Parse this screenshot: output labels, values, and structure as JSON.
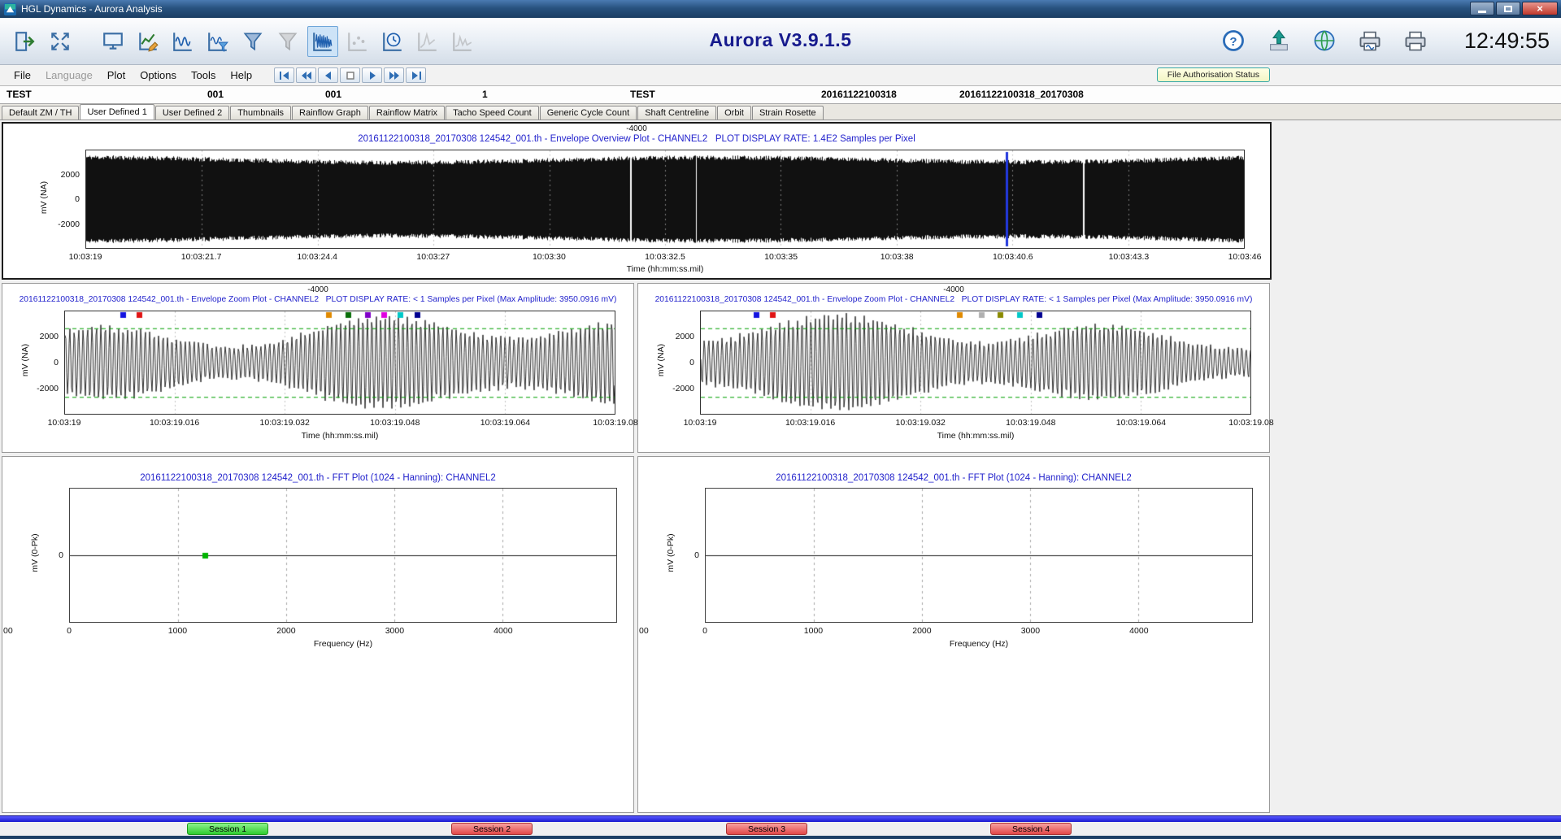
{
  "window": {
    "title": "HGL Dynamics - Aurora Analysis",
    "app_title": "Aurora V3.9.1.5",
    "clock": "12:49:55"
  },
  "toolbar": {
    "left_icons": [
      {
        "name": "exit-icon",
        "shape": "exit"
      },
      {
        "name": "fullscreen-icon",
        "shape": "fullscreen"
      },
      {
        "name": "display-setup-icon",
        "shape": "monitor",
        "gap_before": true
      },
      {
        "name": "plot-setup-icon",
        "shape": "chartpencil"
      },
      {
        "name": "waveform-plot-icon",
        "shape": "wave"
      },
      {
        "name": "filtered-plot-icon",
        "shape": "wavefilter"
      },
      {
        "name": "filter-icon",
        "shape": "funnel"
      },
      {
        "name": "filter-disabled-icon",
        "shape": "funnel",
        "disabled": true
      },
      {
        "name": "envelope-plot-icon",
        "shape": "envelope",
        "selected": true
      },
      {
        "name": "scatter-plot-icon",
        "shape": "chart",
        "disabled": true
      },
      {
        "name": "clock-plot-icon",
        "shape": "clockchart"
      },
      {
        "name": "spectrum-plot-icon",
        "shape": "wave2",
        "disabled": true
      },
      {
        "name": "spectrum2-plot-icon",
        "shape": "wave3",
        "disabled": true
      }
    ],
    "right_icons": [
      {
        "name": "help-icon",
        "shape": "help"
      },
      {
        "name": "upload-icon",
        "shape": "upload"
      },
      {
        "name": "globe-icon",
        "shape": "globe"
      },
      {
        "name": "print-preview-icon",
        "shape": "printwave"
      },
      {
        "name": "print-icon",
        "shape": "printer"
      }
    ]
  },
  "menubar": {
    "menus": [
      {
        "label": "File",
        "disabled": false
      },
      {
        "label": "Language",
        "disabled": true
      },
      {
        "label": "Plot",
        "disabled": false
      },
      {
        "label": "Options",
        "disabled": false
      },
      {
        "label": "Tools",
        "disabled": false
      },
      {
        "label": "Help",
        "disabled": false
      }
    ],
    "nav_buttons": [
      {
        "name": "nav-first-button",
        "shape": "first"
      },
      {
        "name": "nav-rewind-button",
        "shape": "prev2"
      },
      {
        "name": "nav-previous-button",
        "shape": "prev"
      },
      {
        "name": "nav-stop-button",
        "shape": "stop"
      },
      {
        "name": "nav-next-button",
        "shape": "next"
      },
      {
        "name": "nav-forward-button",
        "shape": "next2"
      },
      {
        "name": "nav-last-button",
        "shape": "last"
      }
    ],
    "file_auth_button": "File Authorisation Status"
  },
  "info_fields": [
    "TEST",
    "001",
    "001",
    "1",
    "TEST",
    "20161122100318",
    "20161122100318_20170308"
  ],
  "tabs": [
    {
      "label": "Default ZM / TH",
      "active": false
    },
    {
      "label": "User Defined 1",
      "active": true
    },
    {
      "label": "User Defined 2",
      "active": false
    },
    {
      "label": "Thumbnails",
      "active": false
    },
    {
      "label": "Rainflow Graph",
      "active": false
    },
    {
      "label": "Rainflow Matrix",
      "active": false
    },
    {
      "label": "Tacho Speed Count",
      "active": false
    },
    {
      "label": "Generic Cycle Count",
      "active": false
    },
    {
      "label": "Shaft Centreline",
      "active": false
    },
    {
      "label": "Orbit",
      "active": false
    },
    {
      "label": "Strain Rosette",
      "active": false
    }
  ],
  "plots": {
    "overview": {
      "top_label": "-4000",
      "title": "20161122100318_20170308 124542_001.th - Envelope Overview Plot - CHANNEL2   PLOT DISPLAY RATE: 1.4E2 Samples per Pixel",
      "y_label": "mV (NA)",
      "y_ticks": [
        "2000",
        "0",
        "-2000"
      ],
      "x_ticks": [
        "10:03:19",
        "10:03:21.7",
        "10:03:24.4",
        "10:03:27",
        "10:03:30",
        "10:03:32.5",
        "10:03:35",
        "10:03:38",
        "10:03:40.6",
        "10:03:43.3",
        "10:03:46"
      ],
      "x_label": "Time (hh:mm:ss.mil)",
      "waveform_color": "#111111",
      "cursor_color": "#2238dd",
      "cursor_fraction": 0.795
    },
    "zoom_left": {
      "top_label": "-4000",
      "title": "20161122100318_20170308 124542_001.th - Envelope Zoom Plot - CHANNEL2   PLOT DISPLAY RATE: < 1 Samples per Pixel (Max Amplitude: 3950.0916 mV)",
      "y_label": "mV (NA)",
      "y_ticks": [
        "2000",
        "0",
        "-2000"
      ],
      "x_ticks": [
        "10:03:19",
        "10:03:19.016",
        "10:03:19.032",
        "10:03:19.048",
        "10:03:19.064",
        "10:03:19.08"
      ],
      "x_label": "Time (hh:mm:ss.mil)",
      "limit_line_color": "#00a000",
      "waveform_color": "#161616",
      "markers": [
        {
          "f": 0.105,
          "color": "#1414e0"
        },
        {
          "f": 0.135,
          "color": "#e01414"
        },
        {
          "f": 0.48,
          "color": "#e08a00"
        },
        {
          "f": 0.515,
          "color": "#0a6e0a"
        },
        {
          "f": 0.55,
          "color": "#8000c8"
        },
        {
          "f": 0.58,
          "color": "#e000e0"
        },
        {
          "f": 0.61,
          "color": "#00c8c8"
        },
        {
          "f": 0.64,
          "color": "#000090"
        }
      ]
    },
    "zoom_right": {
      "top_label": "-4000",
      "title": "20161122100318_20170308 124542_001.th - Envelope Zoom Plot - CHANNEL2   PLOT DISPLAY RATE: < 1 Samples per Pixel (Max Amplitude: 3950.0916 mV)",
      "y_label": "mV (NA)",
      "y_ticks": [
        "2000",
        "0",
        "-2000"
      ],
      "x_ticks": [
        "10:03:19",
        "10:03:19.016",
        "10:03:19.032",
        "10:03:19.048",
        "10:03:19.064",
        "10:03:19.08"
      ],
      "x_label": "Time (hh:mm:ss.mil)",
      "limit_line_color": "#00a000",
      "waveform_color": "#161616",
      "markers": [
        {
          "f": 0.1,
          "color": "#1414e0"
        },
        {
          "f": 0.13,
          "color": "#e01414"
        },
        {
          "f": 0.47,
          "color": "#e08a00"
        },
        {
          "f": 0.51,
          "color": "#b0b0b0"
        },
        {
          "f": 0.545,
          "color": "#8a8a00"
        },
        {
          "f": 0.58,
          "color": "#00c8c8"
        },
        {
          "f": 0.615,
          "color": "#000090"
        }
      ]
    },
    "fft_left": {
      "title": "20161122100318_20170308 124542_001.th - FFT Plot (1024 - Hanning): CHANNEL2",
      "y_label": "mV (0-Pk)",
      "y_ticks": [
        "0"
      ],
      "x_ticks": [
        "0",
        "1000",
        "2000",
        "3000",
        "4000"
      ],
      "x_label": "Frequency (Hz)",
      "corner_label": "00",
      "x_max_hz": 5050,
      "marker": {
        "hz": 1250,
        "color": "#00b400"
      }
    },
    "fft_right": {
      "title": "20161122100318_20170308 124542_001.th - FFT Plot (1024 - Hanning): CHANNEL2",
      "y_label": "mV (0-Pk)",
      "y_ticks": [
        "0"
      ],
      "x_ticks": [
        "0",
        "1000",
        "2000",
        "3000",
        "4000"
      ],
      "x_label": "Frequency (Hz)",
      "corner_label": "00",
      "x_max_hz": 5050,
      "marker": null
    }
  },
  "sessions": [
    {
      "label": "Session 1",
      "active": true,
      "color_top": "#8df28d",
      "color_bottom": "#2fcb2f",
      "border": "#199a19"
    },
    {
      "label": "Session 2",
      "active": false,
      "color_top": "#f7a0a0",
      "color_bottom": "#e24848",
      "border": "#a83030"
    },
    {
      "label": "Session 3",
      "active": false,
      "color_top": "#f7a0a0",
      "color_bottom": "#e24848",
      "border": "#a83030"
    },
    {
      "label": "Session 4",
      "active": false,
      "color_top": "#f7a0a0",
      "color_bottom": "#e24848",
      "border": "#a83030"
    }
  ]
}
